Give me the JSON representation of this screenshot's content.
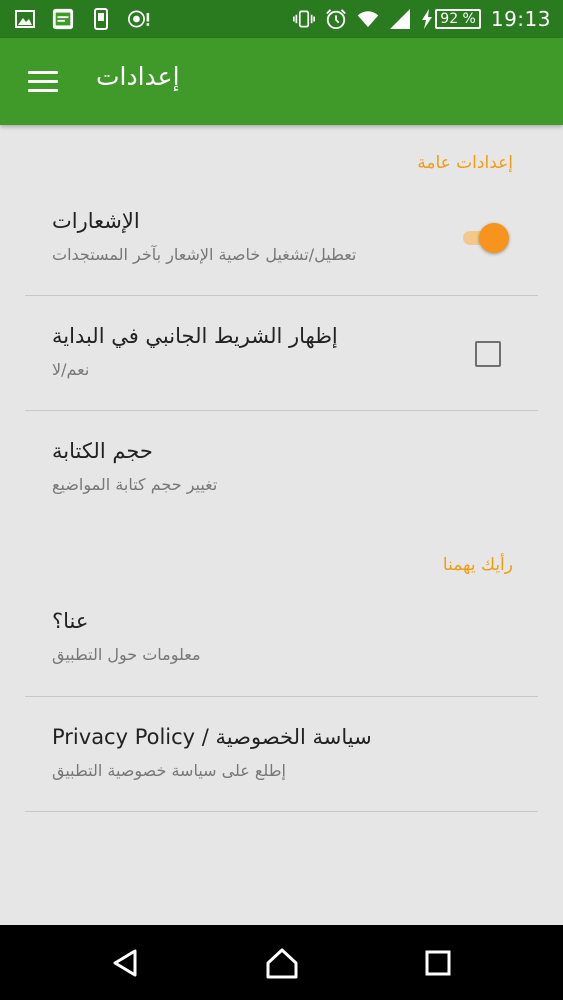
{
  "status_bar": {
    "battery_percent": "92 %",
    "time": "19:13",
    "color": "#2a7a1f"
  },
  "app_bar": {
    "title": "إعدادات",
    "color": "#3f9a2a"
  },
  "sections": [
    {
      "header": "إعدادات عامة",
      "items": [
        {
          "title": "الإشعارات",
          "summary": "تعطيل/تشغيل خاصية الإشعار بآخر المستجدات",
          "control": "toggle",
          "checked": true
        },
        {
          "title": "إظهار الشريط الجانبي في البداية",
          "summary": "نعم/لا",
          "control": "checkbox",
          "checked": false
        },
        {
          "title": "حجم الكتابة",
          "summary": "تغيير حجم كتابة المواضيع",
          "control": "none"
        }
      ]
    },
    {
      "header": "رأيك يهمنا",
      "items": [
        {
          "title": "عنا؟",
          "summary": "معلومات حول التطبيق",
          "control": "none"
        },
        {
          "title": "سياسة الخصوصية / Privacy Policy",
          "summary": "إطلع على سياسة خصوصية التطبيق",
          "control": "none"
        }
      ]
    }
  ],
  "accent_color": "#f7941d",
  "nav_bar": {
    "icons": [
      "back-icon",
      "home-icon",
      "recents-icon"
    ]
  }
}
